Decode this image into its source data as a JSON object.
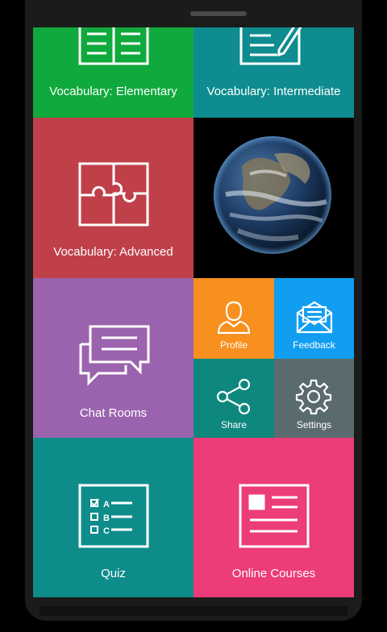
{
  "tiles": {
    "vocab_elementary": {
      "label": "Vocabulary: Elementary",
      "color": "#10a93d",
      "icon": "book-icon"
    },
    "vocab_intermediate": {
      "label": "Vocabulary: Intermediate",
      "color": "#0e8c8f",
      "icon": "notepad-pencil-icon"
    },
    "vocab_advanced": {
      "label": "Vocabulary: Advanced",
      "color": "#c0404a",
      "icon": "puzzle-icon"
    },
    "earth_image": {
      "icon": "earth-image"
    },
    "chat_rooms": {
      "label": "Chat Rooms",
      "color": "#9b63ae",
      "icon": "chat-bubbles-icon"
    },
    "profile": {
      "label": "Profile",
      "color": "#f7901e",
      "icon": "person-icon"
    },
    "feedback": {
      "label": "Feedback",
      "color": "#119ef1",
      "icon": "envelope-icon"
    },
    "share": {
      "label": "Share",
      "color": "#0e877c",
      "icon": "share-icon"
    },
    "settings": {
      "label": "Settings",
      "color": "#5a6b70",
      "icon": "gear-icon"
    },
    "quiz": {
      "label": "Quiz",
      "color": "#0e8c8a",
      "icon": "checklist-icon",
      "options": [
        "A",
        "B",
        "C"
      ]
    },
    "online_courses": {
      "label": "Online Courses",
      "color": "#ec3c7a",
      "icon": "document-icon"
    }
  }
}
